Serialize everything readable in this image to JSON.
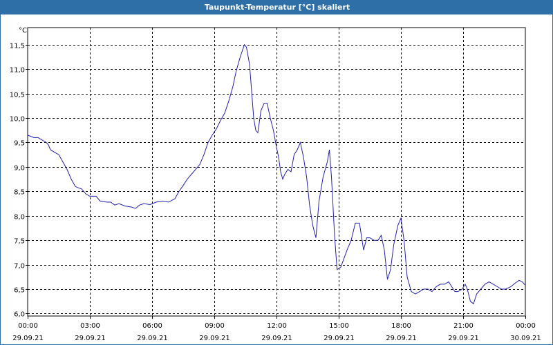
{
  "window": {
    "title": "Taupunkt-Temperatur [°C] skaliert"
  },
  "colors": {
    "titlebar": "#2f6fa7",
    "line": "#1f1fb0",
    "grid": "#000000"
  },
  "chart_data": {
    "type": "line",
    "title": "Taupunkt-Temperatur [°C] skaliert",
    "ylabel": "°C",
    "xlabel": "",
    "ylim": [
      5.95,
      11.85
    ],
    "xlim": [
      0,
      24
    ],
    "grid": true,
    "yticks": [
      {
        "v": 6.0,
        "label": "6,0"
      },
      {
        "v": 6.5,
        "label": "6,5"
      },
      {
        "v": 7.0,
        "label": "7,0"
      },
      {
        "v": 7.5,
        "label": "7,5"
      },
      {
        "v": 8.0,
        "label": "8,0"
      },
      {
        "v": 8.5,
        "label": "8,5"
      },
      {
        "v": 9.0,
        "label": "9,0"
      },
      {
        "v": 9.5,
        "label": "9,5"
      },
      {
        "v": 10.0,
        "label": "10,0"
      },
      {
        "v": 10.5,
        "label": "10,5"
      },
      {
        "v": 11.0,
        "label": "11,0"
      },
      {
        "v": 11.5,
        "label": "11,5"
      }
    ],
    "xticks": [
      {
        "v": 0,
        "time": "00:00",
        "date": "29.09.21"
      },
      {
        "v": 3,
        "time": "03:00",
        "date": "29.09.21"
      },
      {
        "v": 6,
        "time": "06:00",
        "date": "29.09.21"
      },
      {
        "v": 9,
        "time": "09:00",
        "date": "29.09.21"
      },
      {
        "v": 12,
        "time": "12:00",
        "date": "29.09.21"
      },
      {
        "v": 15,
        "time": "15:00",
        "date": "29.09.21"
      },
      {
        "v": 18,
        "time": "18:00",
        "date": "29.09.21"
      },
      {
        "v": 21,
        "time": "21:00",
        "date": "29.09.21"
      },
      {
        "v": 24,
        "time": "00:00",
        "date": "30.09.21"
      }
    ],
    "series": [
      {
        "points": [
          [
            0.0,
            9.65
          ],
          [
            0.3,
            9.6
          ],
          [
            0.5,
            9.6
          ],
          [
            0.7,
            9.55
          ],
          [
            0.9,
            9.5
          ],
          [
            1.0,
            9.45
          ],
          [
            1.1,
            9.35
          ],
          [
            1.3,
            9.3
          ],
          [
            1.5,
            9.25
          ],
          [
            1.7,
            9.1
          ],
          [
            1.9,
            8.95
          ],
          [
            2.1,
            8.75
          ],
          [
            2.3,
            8.6
          ],
          [
            2.4,
            8.58
          ],
          [
            2.6,
            8.55
          ],
          [
            2.8,
            8.45
          ],
          [
            3.0,
            8.4
          ],
          [
            3.3,
            8.4
          ],
          [
            3.5,
            8.3
          ],
          [
            3.8,
            8.28
          ],
          [
            4.0,
            8.28
          ],
          [
            4.2,
            8.22
          ],
          [
            4.4,
            8.25
          ],
          [
            4.7,
            8.2
          ],
          [
            5.0,
            8.18
          ],
          [
            5.2,
            8.15
          ],
          [
            5.4,
            8.22
          ],
          [
            5.6,
            8.25
          ],
          [
            5.9,
            8.23
          ],
          [
            6.2,
            8.28
          ],
          [
            6.5,
            8.3
          ],
          [
            6.8,
            8.28
          ],
          [
            7.1,
            8.35
          ],
          [
            7.3,
            8.5
          ],
          [
            7.5,
            8.62
          ],
          [
            7.7,
            8.75
          ],
          [
            7.9,
            8.85
          ],
          [
            8.1,
            8.95
          ],
          [
            8.3,
            9.05
          ],
          [
            8.5,
            9.25
          ],
          [
            8.7,
            9.5
          ],
          [
            8.9,
            9.65
          ],
          [
            9.1,
            9.78
          ],
          [
            9.3,
            9.95
          ],
          [
            9.5,
            10.1
          ],
          [
            9.7,
            10.35
          ],
          [
            9.9,
            10.65
          ],
          [
            10.05,
            10.95
          ],
          [
            10.25,
            11.25
          ],
          [
            10.45,
            11.5
          ],
          [
            10.55,
            11.45
          ],
          [
            10.7,
            11.1
          ],
          [
            10.8,
            10.55
          ],
          [
            10.9,
            10.0
          ],
          [
            11.0,
            9.75
          ],
          [
            11.1,
            9.7
          ],
          [
            11.25,
            10.15
          ],
          [
            11.4,
            10.3
          ],
          [
            11.55,
            10.3
          ],
          [
            11.7,
            10.0
          ],
          [
            11.85,
            9.75
          ],
          [
            12.0,
            9.4
          ],
          [
            12.1,
            9.2
          ],
          [
            12.2,
            8.9
          ],
          [
            12.3,
            8.75
          ],
          [
            12.4,
            8.85
          ],
          [
            12.55,
            8.95
          ],
          [
            12.7,
            8.9
          ],
          [
            12.85,
            9.25
          ],
          [
            13.0,
            9.35
          ],
          [
            13.15,
            9.5
          ],
          [
            13.3,
            9.2
          ],
          [
            13.45,
            8.8
          ],
          [
            13.6,
            8.2
          ],
          [
            13.75,
            7.8
          ],
          [
            13.9,
            7.55
          ],
          [
            14.05,
            8.3
          ],
          [
            14.25,
            8.8
          ],
          [
            14.45,
            9.1
          ],
          [
            14.55,
            9.35
          ],
          [
            14.65,
            8.8
          ],
          [
            14.8,
            7.6
          ],
          [
            14.92,
            6.9
          ],
          [
            15.1,
            6.95
          ],
          [
            15.4,
            7.3
          ],
          [
            15.6,
            7.5
          ],
          [
            15.8,
            7.85
          ],
          [
            16.0,
            7.85
          ],
          [
            16.2,
            7.3
          ],
          [
            16.35,
            7.55
          ],
          [
            16.5,
            7.55
          ],
          [
            16.7,
            7.5
          ],
          [
            16.9,
            7.5
          ],
          [
            17.05,
            7.6
          ],
          [
            17.2,
            7.3
          ],
          [
            17.35,
            6.7
          ],
          [
            17.5,
            6.9
          ],
          [
            17.65,
            7.4
          ],
          [
            17.85,
            7.8
          ],
          [
            18.0,
            7.95
          ],
          [
            18.15,
            7.5
          ],
          [
            18.3,
            6.75
          ],
          [
            18.5,
            6.45
          ],
          [
            18.7,
            6.4
          ],
          [
            18.9,
            6.45
          ],
          [
            19.1,
            6.5
          ],
          [
            19.3,
            6.5
          ],
          [
            19.5,
            6.45
          ],
          [
            19.7,
            6.55
          ],
          [
            19.9,
            6.6
          ],
          [
            20.1,
            6.6
          ],
          [
            20.3,
            6.65
          ],
          [
            20.45,
            6.55
          ],
          [
            20.6,
            6.45
          ],
          [
            20.75,
            6.45
          ],
          [
            20.95,
            6.5
          ],
          [
            21.1,
            6.6
          ],
          [
            21.2,
            6.5
          ],
          [
            21.35,
            6.25
          ],
          [
            21.5,
            6.2
          ],
          [
            21.65,
            6.4
          ],
          [
            21.85,
            6.5
          ],
          [
            22.05,
            6.6
          ],
          [
            22.25,
            6.65
          ],
          [
            22.45,
            6.6
          ],
          [
            22.65,
            6.55
          ],
          [
            22.85,
            6.5
          ],
          [
            23.05,
            6.5
          ],
          [
            23.3,
            6.55
          ],
          [
            23.5,
            6.62
          ],
          [
            23.7,
            6.68
          ],
          [
            23.85,
            6.65
          ],
          [
            24.0,
            6.58
          ]
        ]
      }
    ]
  }
}
